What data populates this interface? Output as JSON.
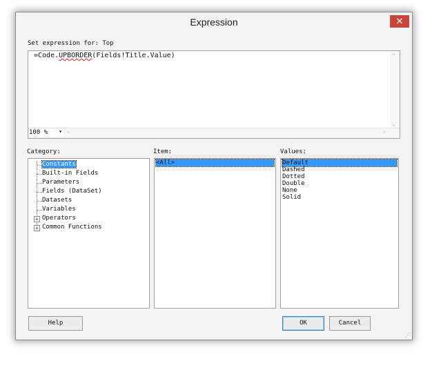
{
  "dialog": {
    "title": "Expression",
    "close_glyph": "✕"
  },
  "expression": {
    "label": "Set expression for: Top",
    "prefix": "=Code.",
    "squiggle": "UPBORDER",
    "suffix": "(Fields!Title.Value)",
    "zoom": "100 %"
  },
  "category": {
    "label": "Category:",
    "items": [
      {
        "label": "Constants",
        "selected": true,
        "expandable": false
      },
      {
        "label": "Built-in Fields",
        "selected": false,
        "expandable": false
      },
      {
        "label": "Parameters",
        "selected": false,
        "expandable": false
      },
      {
        "label": "Fields (DataSet)",
        "selected": false,
        "expandable": false
      },
      {
        "label": "Datasets",
        "selected": false,
        "expandable": false
      },
      {
        "label": "Variables",
        "selected": false,
        "expandable": false
      },
      {
        "label": "Operators",
        "selected": false,
        "expandable": true
      },
      {
        "label": "Common Functions",
        "selected": false,
        "expandable": true
      }
    ]
  },
  "item": {
    "label": "Item:",
    "items": [
      "<All>"
    ]
  },
  "values": {
    "label": "Values:",
    "items": [
      "Default",
      "Dashed",
      "Dotted",
      "Double",
      "None",
      "Solid"
    ]
  },
  "buttons": {
    "help": "Help",
    "ok": "OK",
    "cancel": "Cancel"
  }
}
